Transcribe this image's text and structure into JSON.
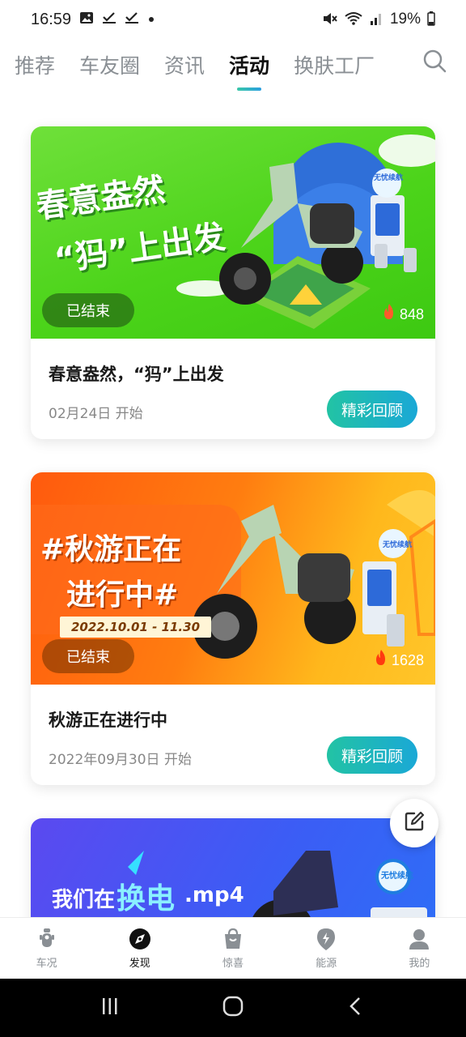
{
  "status_bar": {
    "time": "16:59",
    "battery": "19%"
  },
  "tabs": [
    {
      "label": "推荐",
      "active": false
    },
    {
      "label": "车友圈",
      "active": false
    },
    {
      "label": "资讯",
      "active": false
    },
    {
      "label": "活动",
      "active": true
    },
    {
      "label": "换肤工厂",
      "active": false
    }
  ],
  "cards": [
    {
      "banner_line1": "春意盎然",
      "banner_line2": "“犸”上出发",
      "banner_tag": "无忧续航",
      "status_badge": "已结束",
      "heat": "848",
      "title": "春意盎然，“犸”上出发",
      "date": "02月24日 开始",
      "button": "精彩回顾"
    },
    {
      "banner_line1": "#秋游正在",
      "banner_line2": "进行中#",
      "banner_dates": "2022.10.01 - 11.30",
      "banner_tag": "无忧续航",
      "status_badge": "已结束",
      "heat": "1628",
      "title": "秋游正在进行中",
      "date": "2022年09月30日 开始",
      "button": "精彩回顾"
    },
    {
      "banner_line1a": "我们在",
      "banner_line1b": "换电",
      "banner_line1c": ".mp4",
      "banner_tag": "无忧续航"
    }
  ],
  "bottom_nav": [
    {
      "label": "车况",
      "icon": "scooter-icon",
      "active": false
    },
    {
      "label": "发现",
      "icon": "compass-icon",
      "active": true
    },
    {
      "label": "惊喜",
      "icon": "shopping-bag-icon",
      "active": false
    },
    {
      "label": "能源",
      "icon": "charge-location-icon",
      "active": false
    },
    {
      "label": "我的",
      "icon": "profile-icon",
      "active": false
    }
  ],
  "colors": {
    "accent_gradient_start": "#22c3a4",
    "accent_gradient_end": "#1aa8d6"
  }
}
